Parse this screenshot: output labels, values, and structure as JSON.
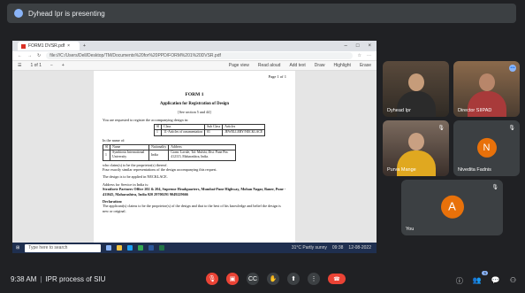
{
  "presenting": {
    "text": "Dyhead Ipr is presenting"
  },
  "browser": {
    "tab_title": "FORM1 DVSR.pdf",
    "url": "file:///C:/Users/Dell/Desktop/TM/Documents%20for%20PPD/FORM%201%20DVSR.pdf",
    "page_counter": "1 of 1",
    "pdf_tools": [
      "Page view",
      "Read aloud",
      "Add text",
      "Draw",
      "Highlight",
      "Erase"
    ]
  },
  "document": {
    "page_of": "Page 1 of 1",
    "form_title": "FORM 1",
    "form_subtitle": "Application for Registration of Design",
    "rules": "[See section 5 and 44]",
    "request_line": "You are requested to register the accompanying design in:",
    "class_table": {
      "headers": [
        "Sl",
        "Class",
        "Sub Class",
        "Articles"
      ],
      "rows": [
        [
          "1",
          "11-Articles of ornamentation",
          "01",
          "JEWELLERY/NECKLACE"
        ]
      ]
    },
    "name_line": "In the name of:",
    "applicant_table": {
      "headers": [
        "Sl",
        "Name",
        "Nationality",
        "Address"
      ],
      "rows": [
        [
          "1",
          "Symbiosis International University",
          "India",
          "Gram: Lavale, Tal: Mulshi, Dist. Pune Pin: 412115, Maharashtra, India."
        ]
      ]
    },
    "para1": "who claim(s) to be the proprietor(s) thereof.",
    "para2": "Four exactly similar representations of the design accompanying this request.",
    "para3": "The design is to be applied in NECKLACE.",
    "service_heading": "Address for Service in India is:",
    "service_addr": "Stratforte Partners Office 202 & 204, Supreme Headquarters, Mumbai-Pune Highway, Mohan Nagar, Baner, Pune - 411045, Maharashtra, India 020 29700291 9049229666",
    "declaration_heading": "Declaration:",
    "declaration_text": "The applicant(s) claims to be the proprietor(s) of the design and that to the best of his knowledge and belief the design is new or original."
  },
  "taskbar": {
    "search_placeholder": "Type here to search",
    "weather": "31°C Partly sunny",
    "time": "09:38",
    "date": "12-08-2022"
  },
  "participants": [
    {
      "name": "Dyhead Ipr",
      "type": "video"
    },
    {
      "name": "Director SIIPAD",
      "type": "video"
    },
    {
      "name": "Purva Mange",
      "type": "video"
    },
    {
      "name": "Nivedita Fadnis",
      "type": "avatar",
      "initial": "N",
      "color": "#e8710a"
    },
    {
      "name": "You",
      "type": "avatar",
      "initial": "A",
      "color": "#e8710a"
    }
  ],
  "meeting": {
    "time": "9:38 AM",
    "title": "IPR process of SIU"
  },
  "controls": [
    "mic-off",
    "camera-off",
    "captions",
    "raise-hand",
    "present",
    "more",
    "leave-call"
  ],
  "people_count": "5"
}
